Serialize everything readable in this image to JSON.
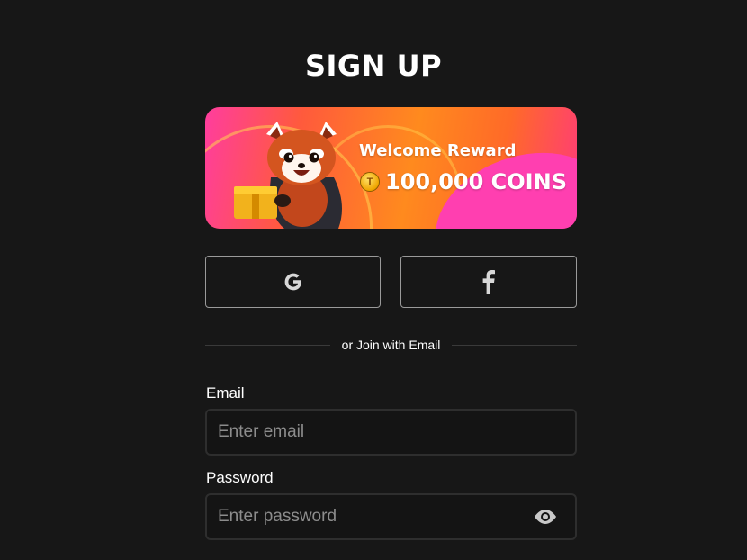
{
  "header": {
    "title": "SIGN UP"
  },
  "banner": {
    "welcome": "Welcome Reward",
    "amount": "100,000 COINS",
    "coin_symbol": "T",
    "colors": {
      "pink": "#ff3d9e",
      "orange": "#ff8a1e"
    }
  },
  "social": {
    "google_icon": "google-icon",
    "facebook_icon": "facebook-icon"
  },
  "divider": {
    "text": "or Join with Email"
  },
  "form": {
    "email_label": "Email",
    "email_placeholder": "Enter email",
    "email_value": "",
    "password_label": "Password",
    "password_placeholder": "Enter password",
    "password_value": "",
    "password_toggle_icon": "eye-icon"
  }
}
